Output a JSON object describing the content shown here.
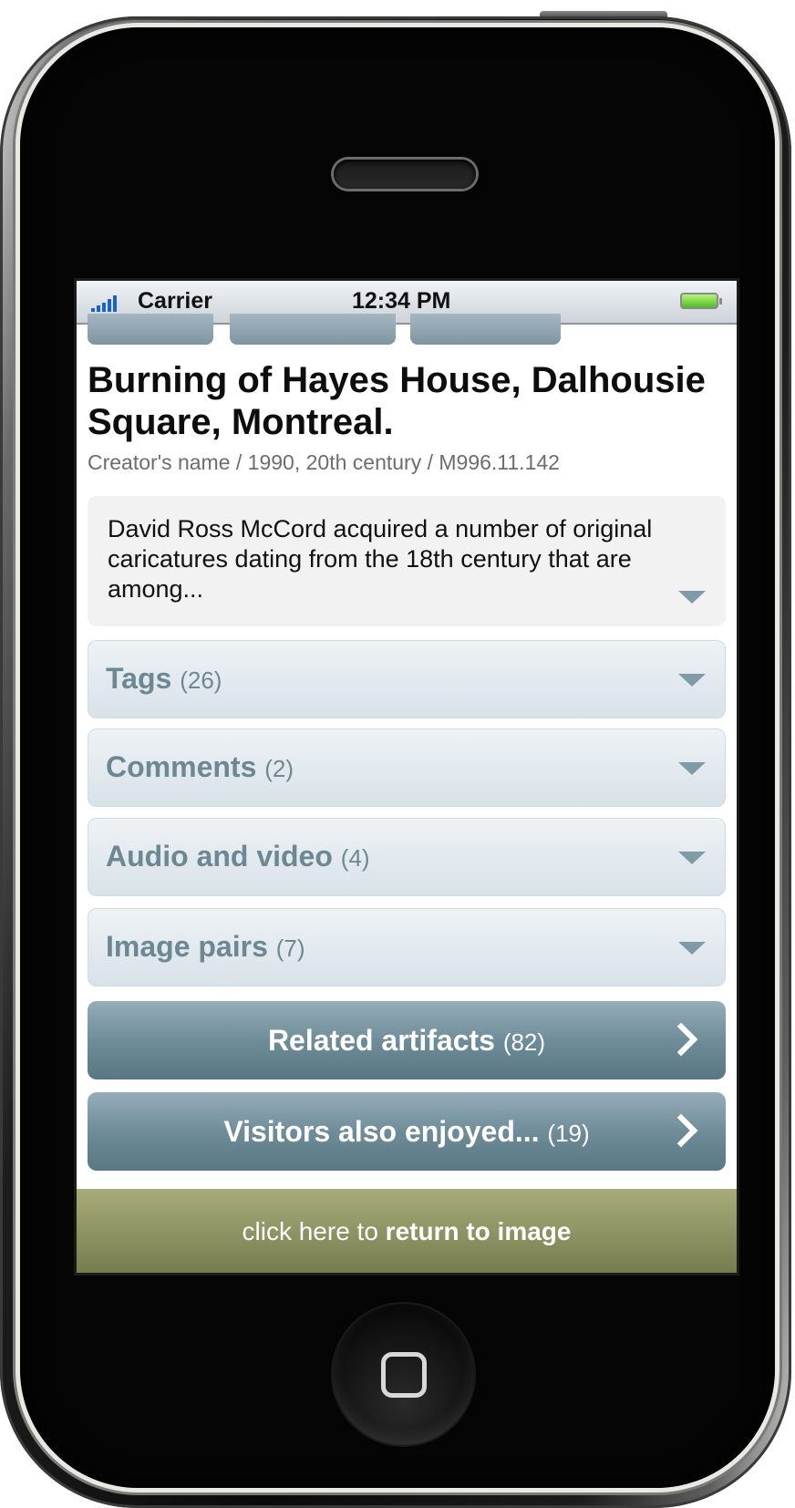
{
  "status_bar": {
    "carrier": "Carrier",
    "time": "12:34 PM"
  },
  "artifact": {
    "title": "Burning of Hayes House, Dalhousie Square, Montreal.",
    "meta": "Creator's name / 1990, 20th century / M996.11.142",
    "description": "David Ross McCord acquired a number of original caricatures dating from the 18th century that are among..."
  },
  "sections": [
    {
      "label": "Tags",
      "count": "(26)"
    },
    {
      "label": "Comments",
      "count": "(2)"
    },
    {
      "label": "Audio and video",
      "count": "(4)"
    },
    {
      "label": "Image pairs",
      "count": "(7)"
    }
  ],
  "nav_buttons": [
    {
      "label": "Related artifacts",
      "count": "(82)"
    },
    {
      "label": "Visitors also enjoyed...",
      "count": "(19)"
    }
  ],
  "footer": {
    "prefix": "click here to ",
    "action": "return to image"
  },
  "icons": {
    "section_toggle": "chevron-down-icon",
    "nav": "chevron-right-icon",
    "home": "home-button-icon"
  },
  "colors": {
    "section_text": "#6c8892",
    "nav_button": "#6f8d99",
    "footer_bar": "#8d9262",
    "signal": "#1a63c5",
    "battery": "#4fbf24"
  }
}
